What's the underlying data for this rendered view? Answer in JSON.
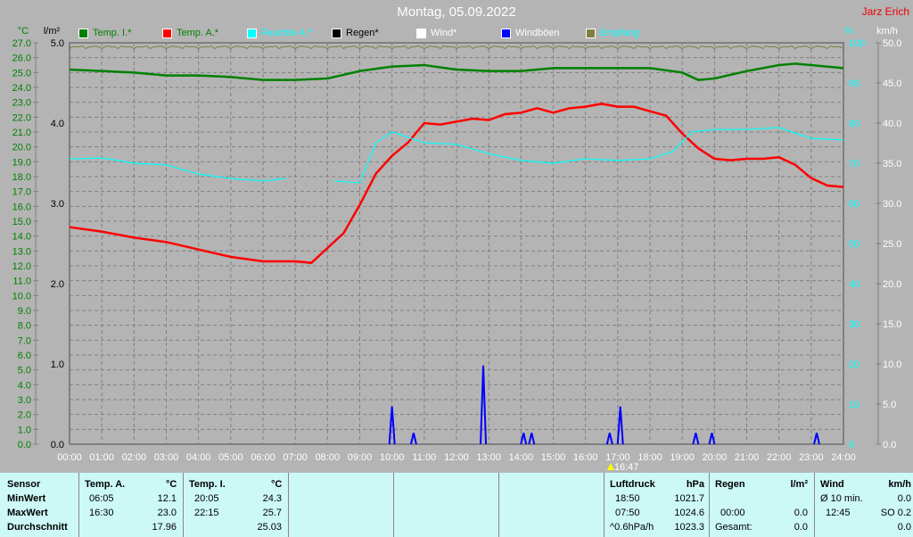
{
  "title": "Montag, 05.09.2022",
  "author": "Jarz Erich",
  "legend": [
    {
      "label": "Temp. I.*",
      "color": "#008000",
      "text_color": "#008000"
    },
    {
      "label": "Temp. A.*",
      "color": "#ff0000",
      "text_color": "#008000"
    },
    {
      "label": "Feuchte A.*",
      "color": "#00ffff",
      "text_color": "#00ffff"
    },
    {
      "label": "Regen*",
      "color": "#000000",
      "text_color": "#000000"
    },
    {
      "label": "Wind*",
      "color": "#ffffff",
      "text_color": "#ffffff"
    },
    {
      "label": "Windböen",
      "color": "#0000ff",
      "text_color": "#ffffff"
    },
    {
      "label": "Empfang",
      "color": "#808040",
      "text_color": "#00ffff"
    }
  ],
  "chart_data": {
    "type": "line",
    "x_unit_labels": {
      "temp": "°C",
      "rain": "l/m²",
      "humidity": "%",
      "wind": "km/h"
    },
    "x_ticks": [
      "00:00",
      "01:00",
      "02:00",
      "03:00",
      "04:00",
      "05:00",
      "06:00",
      "07:00",
      "08:00",
      "09:00",
      "10:00",
      "11:00",
      "12:00",
      "13:00",
      "14:00",
      "15:00",
      "16:00",
      "17:00",
      "18:00",
      "19:00",
      "20:00",
      "21:00",
      "22:00",
      "23:00",
      "24:00"
    ],
    "axes": {
      "temp": {
        "range": [
          0,
          27
        ],
        "ticks": [
          "27.0",
          "26.0",
          "25.0",
          "24.0",
          "23.0",
          "22.0",
          "21.0",
          "20.0",
          "19.0",
          "18.0",
          "17.0",
          "16.0",
          "15.0",
          "14.0",
          "13.0",
          "12.0",
          "11.0",
          "10.0",
          "9.0",
          "8.0",
          "7.0",
          "6.0",
          "5.0",
          "4.0",
          "3.0",
          "2.0",
          "1.0",
          "0.0"
        ]
      },
      "rain": {
        "range": [
          0,
          5
        ],
        "ticks": [
          "5.0",
          "4.0",
          "3.0",
          "2.0",
          "1.0",
          "0.0"
        ]
      },
      "humidity": {
        "range": [
          0,
          100
        ],
        "ticks": [
          "100",
          "90",
          "80",
          "70",
          "60",
          "50",
          "40",
          "30",
          "20",
          "10",
          "0"
        ]
      },
      "wind": {
        "range": [
          0,
          50
        ],
        "ticks": [
          "50.0",
          "45.0",
          "40.0",
          "35.0",
          "30.0",
          "25.0",
          "20.0",
          "15.0",
          "10.0",
          "5.0",
          "0.0"
        ]
      }
    },
    "grid": true,
    "sunset_marker": "16:47",
    "series": [
      {
        "name": "Temp. A.*",
        "axis": "temp",
        "color": "#ff0000",
        "x": [
          0,
          1,
          2,
          3,
          4,
          5,
          6,
          7,
          7.5,
          8,
          8.5,
          9,
          9.5,
          10,
          10.5,
          11,
          11.5,
          12,
          12.5,
          13,
          13.5,
          14,
          14.5,
          15,
          15.5,
          16,
          16.5,
          17,
          17.5,
          18,
          18.5,
          19,
          19.5,
          20,
          20.5,
          21,
          21.5,
          22,
          22.5,
          23,
          23.5,
          24
        ],
        "y": [
          14.6,
          14.3,
          13.9,
          13.6,
          13.1,
          12.6,
          12.3,
          12.3,
          12.2,
          13.2,
          14.2,
          16.1,
          18.2,
          19.4,
          20.3,
          21.6,
          21.5,
          21.7,
          21.9,
          21.8,
          22.2,
          22.3,
          22.6,
          22.3,
          22.6,
          22.7,
          22.9,
          22.7,
          22.7,
          22.4,
          22.1,
          20.9,
          19.9,
          19.2,
          19.1,
          19.2,
          19.2,
          19.3,
          18.8,
          17.9,
          17.4,
          17.3
        ]
      },
      {
        "name": "Temp. I.*",
        "axis": "temp",
        "color": "#008000",
        "x": [
          0,
          1,
          2,
          3,
          4,
          5,
          6,
          7,
          8,
          9,
          10,
          11,
          12,
          13,
          14,
          15,
          16,
          17,
          18,
          19,
          19.5,
          20,
          21,
          22,
          22.5,
          23,
          24
        ],
        "y": [
          25.2,
          25.1,
          25.0,
          24.8,
          24.8,
          24.7,
          24.5,
          24.5,
          24.6,
          25.1,
          25.4,
          25.5,
          25.2,
          25.1,
          25.1,
          25.3,
          25.3,
          25.3,
          25.3,
          25.0,
          24.5,
          24.6,
          25.1,
          25.5,
          25.6,
          25.5,
          25.3
        ]
      },
      {
        "name": "Feuchte A.*",
        "axis": "humidity",
        "color": "#00ffff",
        "segments": [
          {
            "x": [
              0,
              1,
              1.5,
              2,
              3,
              4,
              5,
              6,
              6.7
            ],
            "y": [
              71.1,
              71.3,
              70.7,
              70.0,
              69.6,
              67.3,
              66.2,
              65.6,
              66.2
            ]
          },
          {
            "x": [
              8.2,
              9,
              9.5,
              10,
              11,
              12,
              13,
              14,
              15,
              16,
              17,
              18,
              18.7,
              19.3,
              20,
              21,
              22,
              23,
              24
            ],
            "y": [
              65.6,
              65.1,
              75.1,
              77.8,
              75.1,
              74.7,
              72.4,
              70.7,
              70.0,
              71.1,
              70.7,
              71.1,
              72.9,
              77.8,
              78.4,
              78.4,
              78.9,
              76.2,
              75.8
            ]
          }
        ]
      },
      {
        "name": "Windböen",
        "axis": "wind",
        "color": "#0000ff",
        "events": [
          [
            10.0,
            4.7
          ],
          [
            10.67,
            1.4
          ],
          [
            12.83,
            9.8
          ],
          [
            14.08,
            1.4
          ],
          [
            14.33,
            1.4
          ],
          [
            16.75,
            1.4
          ],
          [
            17.08,
            4.7
          ],
          [
            19.42,
            1.4
          ],
          [
            19.92,
            1.4
          ],
          [
            23.17,
            1.4
          ]
        ]
      },
      {
        "name": "Empfang",
        "axis": "humidity",
        "color": "#808040",
        "value": 99
      }
    ]
  },
  "table": {
    "temp_a": {
      "sensor": "Sensor",
      "head": "Temp. A.",
      "unit": "°C",
      "min_label": "MinWert",
      "max_label": "MaxWert",
      "avg_label": "Durchschnitt",
      "min_time": "06:05",
      "min": "12.1",
      "max_time": "16:30",
      "max": "23.0",
      "avg": "17.96"
    },
    "temp_i": {
      "head": "Temp. I.",
      "unit": "°C",
      "min_time": "20:05",
      "min": "24.3",
      "max_time": "22:15",
      "max": "25.7",
      "avg": "25.03"
    },
    "pressure": {
      "head": "Luftdruck",
      "unit": "hPa",
      "r1a": "18:50",
      "r1b": "1021.7",
      "r2a": "07:50",
      "r2b": "1024.6",
      "r3a": "^0.6hPa/h",
      "r3b": "1023.3"
    },
    "rain": {
      "head": "Regen",
      "unit": "l/m²",
      "r2a": "00:00",
      "r2b": "0.0",
      "r3a": "Gesamt:",
      "r3b": "0.0"
    },
    "wind": {
      "head": "Wind",
      "unit": "km/h",
      "r1a": "Ø 10 min.",
      "r1b": "0.0",
      "r2a": "12:45",
      "r2b": "SO 0.2",
      "r3b": "0.0"
    }
  }
}
